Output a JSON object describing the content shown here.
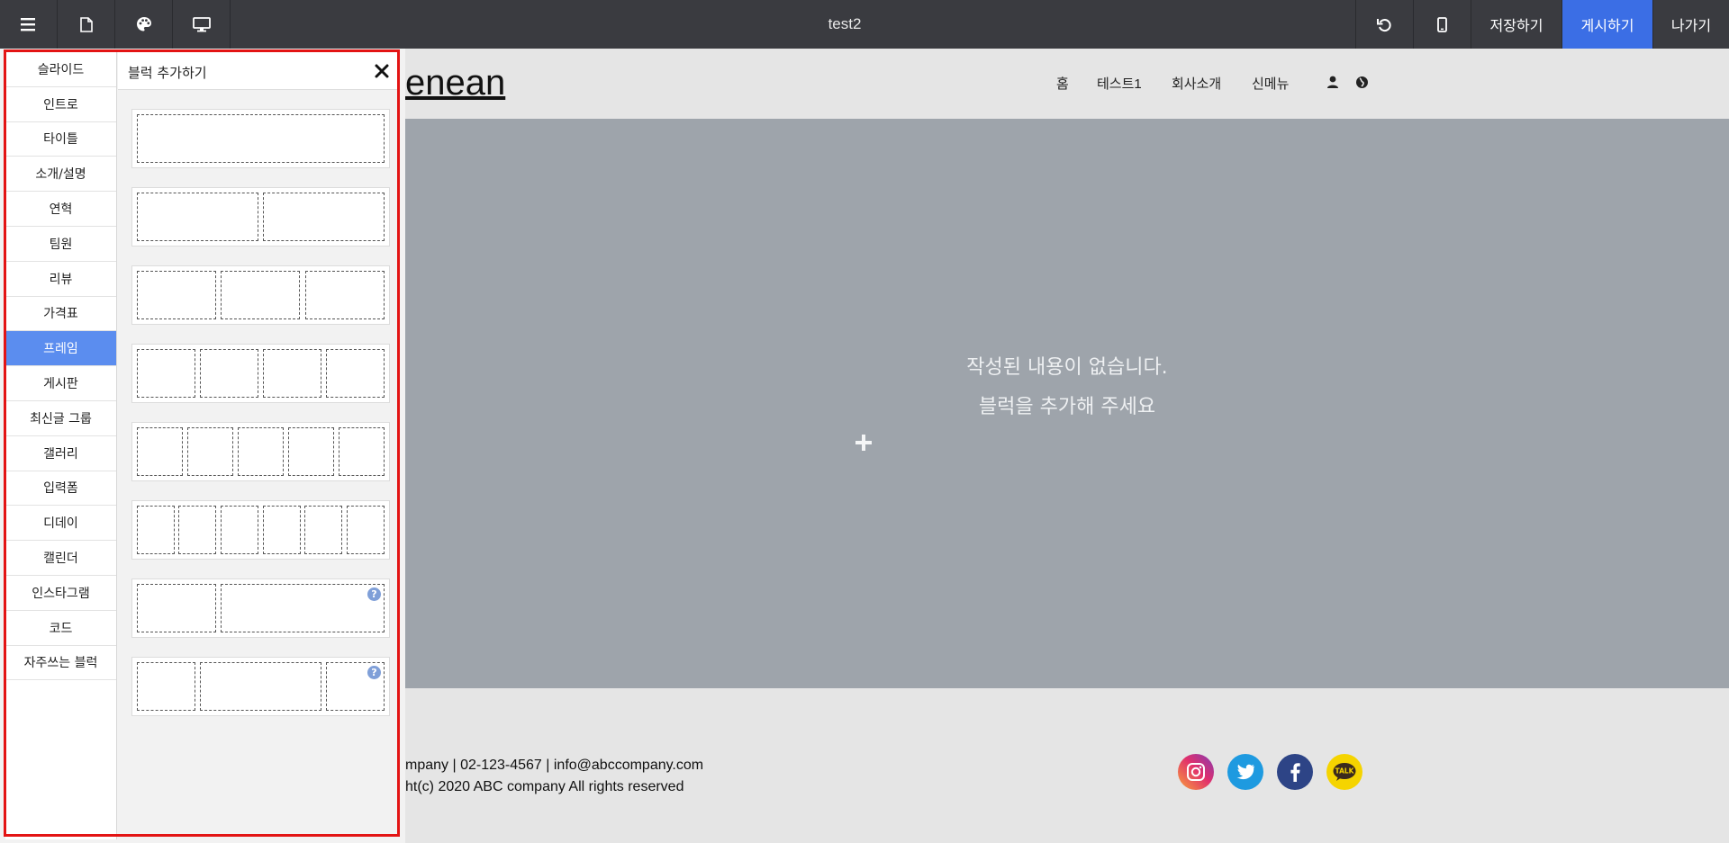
{
  "topbar": {
    "title": "test2",
    "save_label": "저장하기",
    "publish_label": "게시하기",
    "exit_label": "나가기"
  },
  "site": {
    "logo_text": "enean",
    "nav": [
      "홈",
      "테스트1",
      "회사소개",
      "신메뉴"
    ],
    "empty_line1": "작성된 내용이 없습니다.",
    "empty_line2": "블럭을 추가해 주세요",
    "footer_line1": "mpany | 02-123-4567 | info@abccompany.com",
    "footer_line2": "ht(c) 2020 ABC company All rights reserved"
  },
  "panel": {
    "categories": [
      "슬라이드",
      "인트로",
      "타이틀",
      "소개/설명",
      "연혁",
      "팀원",
      "리뷰",
      "가격표",
      "프레임",
      "게시판",
      "최신글 그룹",
      "갤러리",
      "입력폼",
      "디데이",
      "캘린더",
      "인스타그램",
      "코드",
      "자주쓰는 블럭"
    ],
    "active_category": "프레임",
    "block_title": "블럭 추가하기",
    "help_glyph": "?"
  },
  "colors": {
    "topbar_bg": "#3a3b40",
    "publish_bg": "#3b6ee5",
    "active_category_bg": "#5b8def",
    "hero_bg": "#9ea4ab",
    "highlight": "#e31414"
  },
  "icons": [
    "menu-icon",
    "page-icon",
    "palette-icon",
    "desktop-icon",
    "undo-icon",
    "mobile-icon",
    "user-icon",
    "globe-icon",
    "close-icon",
    "plus-icon",
    "instagram-icon",
    "twitter-icon",
    "facebook-icon",
    "kakaotalk-icon"
  ]
}
